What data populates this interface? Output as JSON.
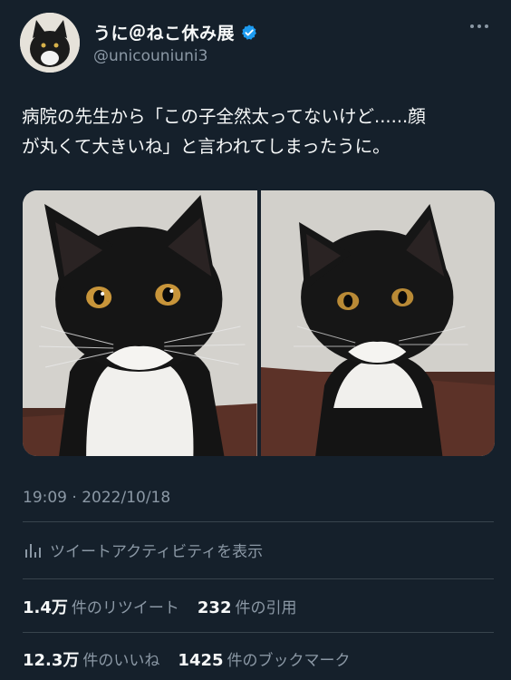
{
  "author": {
    "display_name": "うに＠ねこ休み展",
    "handle": "@unicouniuni3",
    "verified": true
  },
  "tweet": {
    "text": "病院の先生から「この子全然太ってないけど......顔\nが丸くて大きいね」と言われてしまったうに。",
    "timestamp": "19:09 · 2022/10/18"
  },
  "media": [
    {
      "alt": "black and white cat photo 1"
    },
    {
      "alt": "black and white cat photo 2"
    }
  ],
  "activity": {
    "label": "ツイートアクティビティを表示",
    "icon": "bar-chart-icon"
  },
  "stats": {
    "retweets_num": "1.4万",
    "retweets_label": "件のリツイート",
    "quotes_num": "232",
    "quotes_label": "件の引用",
    "likes_num": "12.3万",
    "likes_label": "件のいいね",
    "bookmarks_num": "1425",
    "bookmarks_label": "件のブックマーク"
  },
  "colors": {
    "background": "#15202b",
    "text": "#f7f9f9",
    "secondary": "#8b98a5",
    "divider": "#38444d",
    "verified": "#1d9bf0"
  }
}
